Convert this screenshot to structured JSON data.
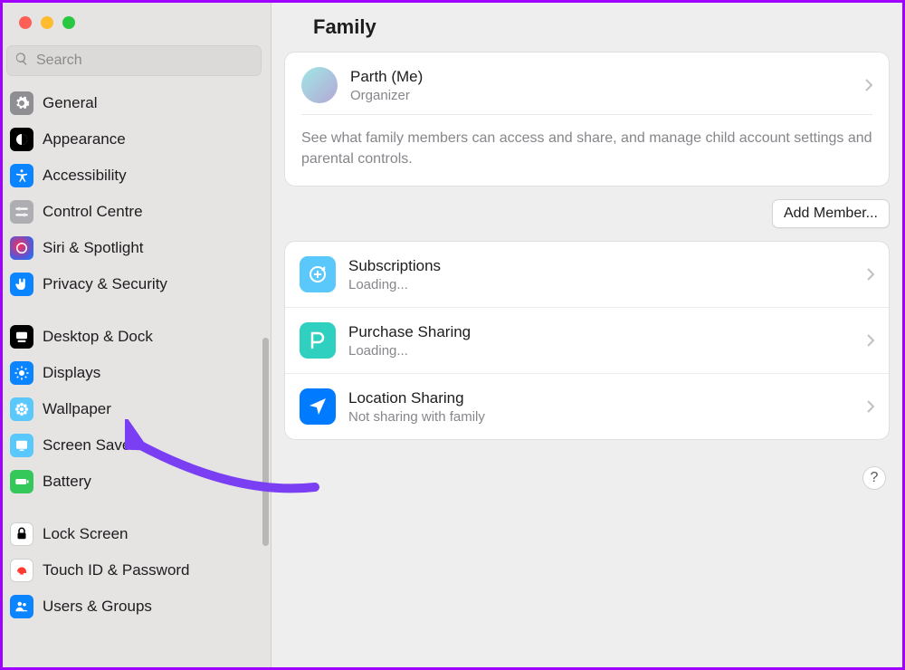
{
  "window": {
    "title": "Family"
  },
  "search": {
    "placeholder": "Search",
    "value": ""
  },
  "sidebar": {
    "groups": [
      [
        {
          "label": "General"
        },
        {
          "label": "Appearance"
        },
        {
          "label": "Accessibility"
        },
        {
          "label": "Control Centre"
        },
        {
          "label": "Siri & Spotlight"
        },
        {
          "label": "Privacy & Security"
        }
      ],
      [
        {
          "label": "Desktop & Dock"
        },
        {
          "label": "Displays"
        },
        {
          "label": "Wallpaper"
        },
        {
          "label": "Screen Saver"
        },
        {
          "label": "Battery"
        }
      ],
      [
        {
          "label": "Lock Screen"
        },
        {
          "label": "Touch ID & Password"
        },
        {
          "label": "Users & Groups"
        }
      ]
    ]
  },
  "family": {
    "organizer": {
      "name": "Parth (Me)",
      "role": "Organizer"
    },
    "description": "See what family members can access and share, and manage child account settings and parental controls.",
    "add_member_label": "Add Member...",
    "features": [
      {
        "title": "Subscriptions",
        "subtitle": "Loading..."
      },
      {
        "title": "Purchase Sharing",
        "subtitle": "Loading..."
      },
      {
        "title": "Location Sharing",
        "subtitle": "Not sharing with family"
      }
    ]
  },
  "help_label": "?",
  "colors": {
    "accent_blue": "#0a84ff",
    "annotation_purple": "#7a3ff2"
  }
}
